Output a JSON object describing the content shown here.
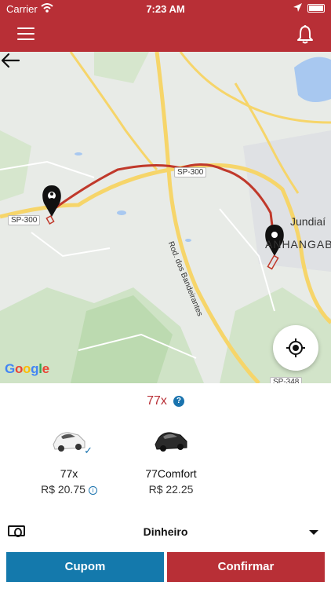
{
  "status_bar": {
    "carrier": "Carrier",
    "time": "7:23 AM"
  },
  "header": {
    "menu_icon": "hamburger-menu-icon",
    "bell_icon": "notification-bell-icon",
    "color": "#b82f36"
  },
  "map": {
    "road_labels": [
      "SP-300",
      "SP-300",
      "SP-348"
    ],
    "highway_label": "Rod. dos Bandeirantes",
    "city_labels": [
      "Jundiaí",
      "ANHANGABAÚ"
    ],
    "attribution": "Google",
    "route_color": "#c0392b"
  },
  "service": {
    "header": "77x",
    "vehicles": [
      {
        "name": "77x",
        "price": "R$ 20.75",
        "selected": true
      },
      {
        "name": "77Comfort",
        "price": "R$ 22.25",
        "selected": false
      }
    ]
  },
  "payment": {
    "method": "Dinheiro"
  },
  "actions": {
    "coupon_label": "Cupom",
    "confirm_label": "Confirmar"
  },
  "colors": {
    "primary": "#b82f36",
    "secondary": "#1479ac"
  }
}
